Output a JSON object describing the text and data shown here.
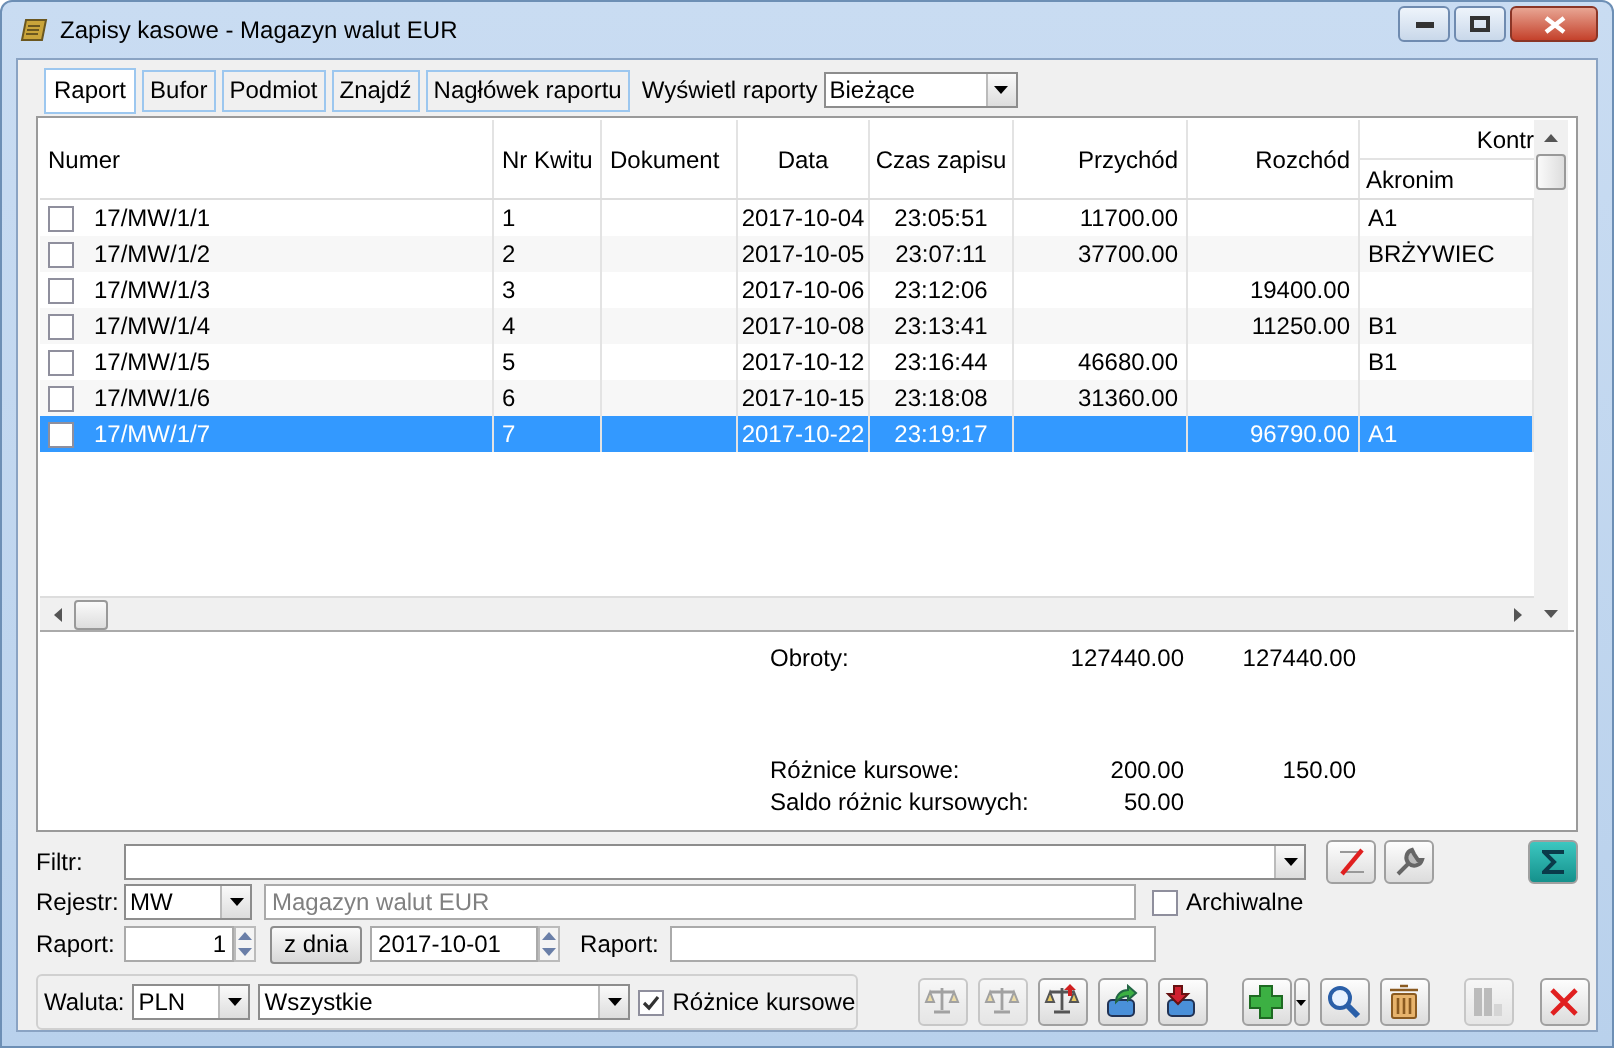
{
  "window": {
    "title": "Zapisy kasowe - Magazyn walut EUR"
  },
  "tabs": [
    {
      "label": "Raport",
      "selected": true
    },
    {
      "label": "Bufor",
      "selected": false
    },
    {
      "label": "Podmiot",
      "selected": false
    },
    {
      "label": "Znajdź",
      "selected": false
    },
    {
      "label": "Nagłówek raportu",
      "selected": false
    }
  ],
  "display_reports": {
    "label": "Wyświetl raporty",
    "value": "Bieżące"
  },
  "table": {
    "column_group": "Kontr",
    "columns": [
      {
        "label": "Numer"
      },
      {
        "label": "Nr Kwitu"
      },
      {
        "label": "Dokument"
      },
      {
        "label": "Data"
      },
      {
        "label": "Czas zapisu"
      },
      {
        "label": "Przychód"
      },
      {
        "label": "Rozchód"
      },
      {
        "label": "Akronim"
      }
    ],
    "rows": [
      {
        "checked": false,
        "selected": false,
        "cells": [
          "17/MW/1/1",
          "1",
          "",
          "2017-10-04",
          "23:05:51",
          "11700.00",
          "",
          "A1"
        ]
      },
      {
        "checked": false,
        "selected": false,
        "cells": [
          "17/MW/1/2",
          "2",
          "",
          "2017-10-05",
          "23:07:11",
          "37700.00",
          "",
          "BRŻYWIEC"
        ]
      },
      {
        "checked": false,
        "selected": false,
        "cells": [
          "17/MW/1/3",
          "3",
          "",
          "2017-10-06",
          "23:12:06",
          "",
          "19400.00",
          ""
        ]
      },
      {
        "checked": false,
        "selected": false,
        "cells": [
          "17/MW/1/4",
          "4",
          "",
          "2017-10-08",
          "23:13:41",
          "",
          "11250.00",
          "B1"
        ]
      },
      {
        "checked": false,
        "selected": false,
        "cells": [
          "17/MW/1/5",
          "5",
          "",
          "2017-10-12",
          "23:16:44",
          "46680.00",
          "",
          "B1"
        ]
      },
      {
        "checked": false,
        "selected": false,
        "cells": [
          "17/MW/1/6",
          "6",
          "",
          "2017-10-15",
          "23:18:08",
          "31360.00",
          "",
          ""
        ]
      },
      {
        "checked": false,
        "selected": true,
        "cells": [
          "17/MW/1/7",
          "7",
          "",
          "2017-10-22",
          "23:19:17",
          "",
          "96790.00",
          "A1"
        ]
      }
    ]
  },
  "totals": {
    "label": "Obroty:",
    "income": "127440.00",
    "expense": "127440.00"
  },
  "exchange": [
    {
      "label": "Różnice kursowe:",
      "income": "200.00",
      "expense": "150.00"
    },
    {
      "label": "Saldo różnic kursowych:",
      "income": "50.00"
    }
  ],
  "filter": {
    "label": "Filtr:"
  },
  "register": {
    "label": "Rejestr:",
    "code": "MW",
    "name": "Magazyn walut EUR",
    "archive": {
      "label": "Archiwalne",
      "checked": false
    }
  },
  "report": {
    "label": "Raport:",
    "number": "1",
    "date_button": "z dnia",
    "date": "2017-10-01",
    "label2": "Raport:"
  },
  "currency": {
    "label": "Waluta:",
    "code": "PLN",
    "scope": "Wszystkie",
    "differences": {
      "label": "Różnice kursowe",
      "checked": true
    }
  },
  "toolbar": [
    {
      "kind": "scales",
      "disabled": true
    },
    {
      "kind": "scales",
      "disabled": true
    },
    {
      "kind": "scales-up",
      "disabled": false
    },
    {
      "kind": "export",
      "disabled": false
    },
    {
      "kind": "import",
      "disabled": false
    },
    {
      "kind": "add",
      "disabled": false
    },
    {
      "kind": "split",
      "disabled": false
    },
    {
      "kind": "search",
      "disabled": false
    },
    {
      "kind": "delete",
      "disabled": false
    },
    {
      "kind": "columns",
      "disabled": true
    },
    {
      "kind": "close",
      "disabled": false
    }
  ]
}
